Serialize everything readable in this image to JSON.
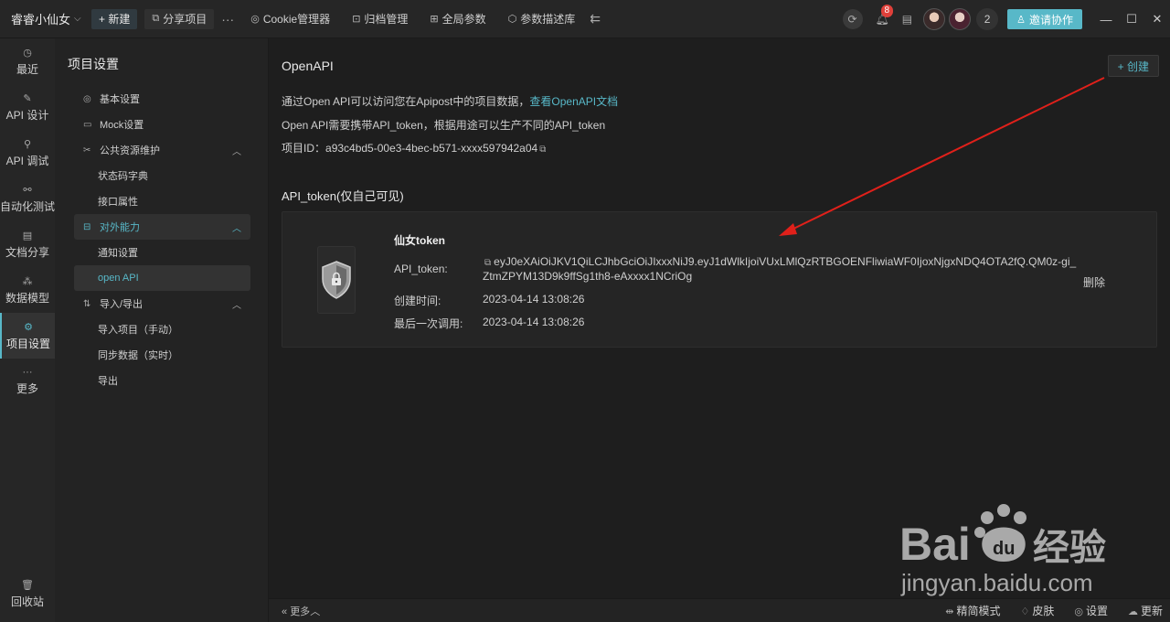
{
  "topbar": {
    "workspace": "睿睿小仙女",
    "new_label": "+ 新建",
    "share_label": "分享项目",
    "more": "···",
    "items": [
      {
        "label": "Cookie管理器"
      },
      {
        "label": "归档管理"
      },
      {
        "label": "全局参数"
      },
      {
        "label": "参数描述库"
      }
    ],
    "notification_count": "8",
    "members_count": "2",
    "invite_label": "邀请协作"
  },
  "leftnav": {
    "items": [
      {
        "label": "最近",
        "icon": "clock-icon"
      },
      {
        "label": "API 设计",
        "icon": "design-icon"
      },
      {
        "label": "API 调试",
        "icon": "debug-icon"
      },
      {
        "label": "自动化测试",
        "icon": "test-icon"
      },
      {
        "label": "文档分享",
        "icon": "doc-icon"
      },
      {
        "label": "数据模型",
        "icon": "model-icon"
      },
      {
        "label": "项目设置",
        "icon": "settings-icon"
      },
      {
        "label": "更多",
        "icon": "more-icon"
      }
    ],
    "bottom": {
      "label": "回收站"
    }
  },
  "settings": {
    "title": "项目设置",
    "menu": [
      {
        "label": "基本设置"
      },
      {
        "label": "Mock设置"
      },
      {
        "label": "公共资源维护"
      },
      {
        "label": "状态码字典"
      },
      {
        "label": "接口属性"
      },
      {
        "label": "对外能力"
      },
      {
        "label": "通知设置"
      },
      {
        "label": "open API"
      },
      {
        "label": "导入/导出"
      },
      {
        "label": "导入项目（手动）"
      },
      {
        "label": "同步数据（实时）"
      },
      {
        "label": "导出"
      }
    ]
  },
  "main": {
    "title": "OpenAPI",
    "create_label": "+ 创建",
    "desc1_prefix": "通过Open API可以访问您在Apipost中的项目数据，",
    "desc1_link": "查看OpenAPI文档",
    "desc2": "Open API需要携带API_token，根据用途可以生产不同的API_token",
    "project_id_label": "项目ID：",
    "project_id": "a93c4bd5-00e3-4bec-b571-xxxx597942a04",
    "section_title": "API_token(仅自己可见)",
    "token": {
      "name": "仙女token",
      "token_label": "API_token:",
      "token_value": "eyJ0eXAiOiJKV1QiLCJhbGciOiJIxxxNiJ9.eyJ1dWlkIjoiVUxLMlQzRTBGOENFliwiaWF0IjoxNjgxNDQ4OTA2fQ.QM0z-gi_ZtmZPYM13D9k9ffSg1th8-eAxxxx1NCriOg",
      "created_label": "创建时间:",
      "created_value": "2023-04-14 13:08:26",
      "last_used_label": "最后一次调用:",
      "last_used_value": "2023-04-14 13:08:26",
      "delete_label": "删除"
    }
  },
  "statusbar": {
    "more_label": "更多",
    "items": [
      {
        "label": "精简模式"
      },
      {
        "label": "皮肤"
      },
      {
        "label": "设置"
      },
      {
        "label": "更新"
      }
    ]
  },
  "watermark": {
    "brand": "Bai",
    "brand2": "经验",
    "url": "jingyan.baidu.com"
  },
  "colors": {
    "accent": "#58b8c8",
    "arrow": "#e0201a",
    "badge": "#e0403a"
  }
}
